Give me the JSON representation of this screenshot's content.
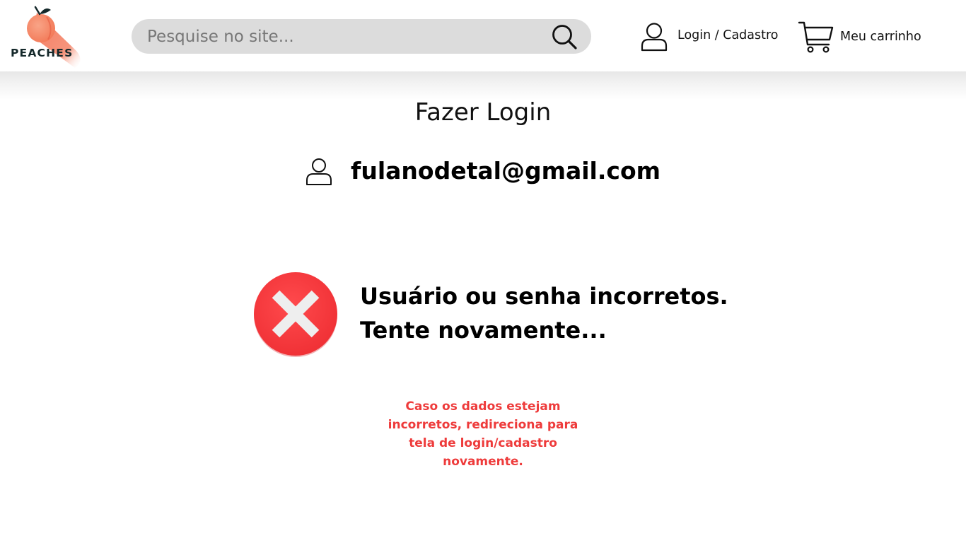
{
  "header": {
    "logo_text": "PEACHES",
    "search_placeholder": "Pesquise no site...",
    "login_label": "Login / Cadastro",
    "cart_label": "Meu carrinho"
  },
  "main": {
    "title": "Fazer Login",
    "email": "fulanodetal@gmail.com",
    "error_line1": "Usuário ou senha incorretos.",
    "error_line2": "Tente novamente...",
    "note": "Caso os dados estejam incorretos, redireciona para tela de login/cadastro novamente."
  },
  "colors": {
    "brand_peach": "#f47a5a",
    "error_red": "#ee3b3b",
    "search_bg": "#dcdcdc"
  },
  "icons": [
    "peach-logo-icon",
    "search-icon",
    "user-icon",
    "cart-icon",
    "error-x-icon"
  ]
}
